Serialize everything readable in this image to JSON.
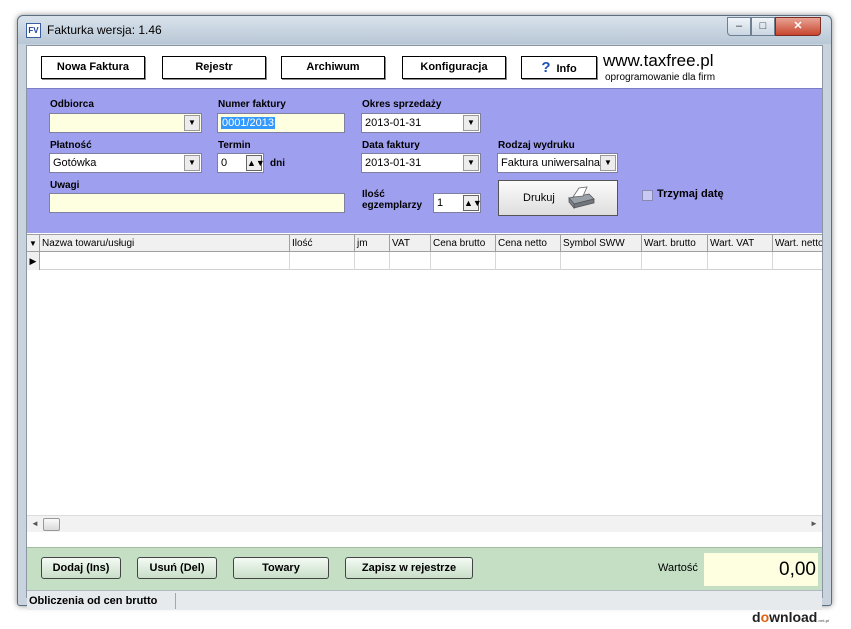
{
  "window": {
    "icon_text": "FV",
    "title": "Fakturka wersja: 1.46",
    "controls": {
      "minimize": "–",
      "maximize": "□",
      "close": "✕"
    }
  },
  "toolbar": {
    "new_invoice": "Nowa Faktura",
    "register": "Rejestr",
    "archive": "Archiwum",
    "config": "Konfiguracja",
    "info": "Info",
    "info_icon": "?",
    "brand": "www.taxfree.pl",
    "brand_sub": "oprogramowanie dla firm"
  },
  "form": {
    "recipient": {
      "label": "Odbiorca",
      "value": ""
    },
    "invoice_number": {
      "label": "Numer faktury",
      "value": "0001/2013"
    },
    "sale_period": {
      "label": "Okres sprzedaży",
      "value": "2013-01-31"
    },
    "payment": {
      "label": "Płatność",
      "value": "Gotówka"
    },
    "term": {
      "label": "Termin",
      "value": "0",
      "unit": "dni"
    },
    "invoice_date": {
      "label": "Data faktury",
      "value": "2013-01-31"
    },
    "print_type": {
      "label": "Rodzaj wydruku",
      "value": "Faktura uniwersalna"
    },
    "notes": {
      "label": "Uwagi",
      "value": ""
    },
    "copies": {
      "label_line1": "Ilość",
      "label_line2": "egzemplarzy",
      "value": "1"
    },
    "print_button": "Drukuj",
    "keep_date": {
      "label": "Trzymaj datę",
      "checked": false
    },
    "dropdown_glyph": "▼",
    "spin_glyph": "▲▼"
  },
  "grid": {
    "header_marker": "▼",
    "row_marker": "▶",
    "columns": [
      "Nazwa towaru/usługi",
      "Ilość",
      "jm",
      "VAT",
      "Cena brutto",
      "Cena netto",
      "Symbol SWW",
      "Wart. brutto",
      "Wart. VAT",
      "Wart. netto"
    ],
    "rows": [
      [
        "",
        "",
        "",
        "",
        "",
        "",
        "",
        "",
        "",
        ""
      ]
    ]
  },
  "scrollbar": {
    "left": "◄",
    "right": "►"
  },
  "bottom": {
    "add": "Dodaj (Ins)",
    "delete": "Usuń (Del)",
    "goods": "Towary",
    "save_register": "Zapisz w rejestrze",
    "value_label": "Wartość",
    "value": "0,00"
  },
  "status": {
    "text": "Obliczenia od cen brutto"
  },
  "watermark": {
    "pre": "d",
    "o": "o",
    "post": "wnload",
    "suffix": ".net.pl"
  }
}
